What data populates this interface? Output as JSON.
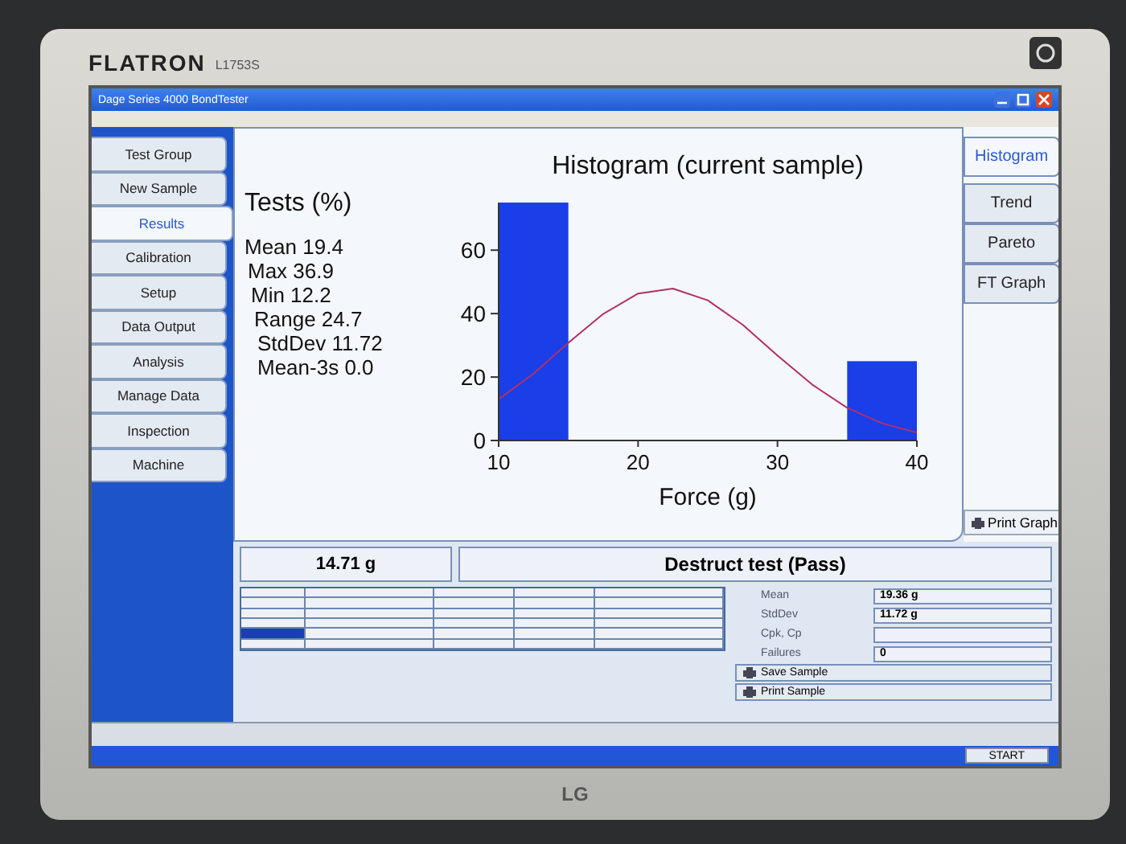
{
  "monitor": {
    "brand": "FLATRON",
    "model": "L1753S",
    "logo": "LG"
  },
  "window": {
    "title": "Dage Series 4000 BondTester"
  },
  "side_tabs": [
    {
      "label": "Test Group",
      "selected": false
    },
    {
      "label": "New Sample",
      "selected": false
    },
    {
      "label": "Results",
      "selected": true
    },
    {
      "label": "Calibration",
      "selected": false
    },
    {
      "label": "Setup",
      "selected": false
    },
    {
      "label": "Data Output",
      "selected": false
    },
    {
      "label": "Analysis",
      "selected": false
    },
    {
      "label": "Manage Data",
      "selected": false
    },
    {
      "label": "Inspection",
      "selected": false
    },
    {
      "label": "Machine",
      "selected": false
    }
  ],
  "stats": {
    "title": "Tests (%)",
    "lines": [
      "Mean 19.4",
      "Max 36.9",
      "Min 12.2",
      "Range 24.7",
      "StdDev 11.72",
      "Mean-3s 0.0"
    ]
  },
  "chart_data": {
    "type": "bar",
    "title": "Histogram (current sample)",
    "xlabel": "Force (g)",
    "x": [
      10,
      12.5,
      15,
      17.5,
      20,
      22.5,
      25,
      27.5,
      30,
      32.5,
      35,
      37.5,
      40
    ],
    "series": [
      {
        "type": "bar",
        "color": "#1a3ee8",
        "values": [
          null,
          75,
          null,
          null,
          null,
          null,
          null,
          null,
          null,
          null,
          null,
          25,
          null
        ]
      },
      {
        "type": "line",
        "color": "#b0306a",
        "values": [
          13.0,
          21.1,
          30.8,
          39.9,
          46.3,
          47.9,
          44.2,
          36.5,
          26.8,
          17.6,
          10.3,
          5.4,
          2.5
        ]
      }
    ],
    "xlim": [
      10,
      40
    ],
    "ylim": [
      0,
      75
    ],
    "xticks": [
      10,
      20,
      30,
      40
    ],
    "yticks": [
      0,
      20,
      40,
      60
    ]
  },
  "graph_tabs": [
    {
      "label": "Histogram",
      "selected": true
    },
    {
      "label": "Trend",
      "selected": false
    },
    {
      "label": "Pareto",
      "selected": false
    },
    {
      "label": "FT Graph",
      "selected": false
    }
  ],
  "print_graph": "Print Graph",
  "readout": {
    "value": "14.71 g",
    "result": "Destruct test (Pass)"
  },
  "table": {
    "rows": [
      {
        "selected": false
      },
      {
        "selected": false
      },
      {
        "selected": false
      },
      {
        "selected": true
      },
      {
        "selected": false
      }
    ]
  },
  "summary": {
    "fields": [
      {
        "label": "Mean",
        "value": "19.36 g"
      },
      {
        "label": "StdDev",
        "value": "11.72 g"
      },
      {
        "label": "Cpk, Cp"
      },
      {
        "label": "Failures",
        "value": "0"
      }
    ],
    "buttons": [
      "Save Sample",
      "Print Sample"
    ]
  },
  "taskbar": {
    "start": "START"
  }
}
